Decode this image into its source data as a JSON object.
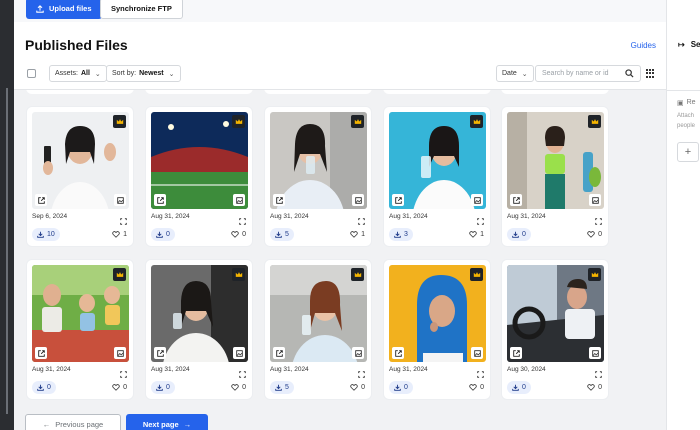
{
  "topbar": {
    "upload_label": "Upload files",
    "ftp_label": "Synchronize FTP"
  },
  "header": {
    "title": "Published Files",
    "guides_label": "Guides"
  },
  "toolbar": {
    "assets_label": "Assets:",
    "assets_value": "All",
    "sort_label": "Sort by:",
    "sort_value": "Newest",
    "date_label": "Date",
    "search_placeholder": "Search by name or id"
  },
  "files": [
    {
      "date": "Sep 6, 2024",
      "downloads": "10",
      "likes": "1",
      "art": "phone"
    },
    {
      "date": "Aug 31, 2024",
      "downloads": "0",
      "likes": "0",
      "art": "stadium"
    },
    {
      "date": "Aug 31, 2024",
      "downloads": "5",
      "likes": "1",
      "art": "kitchen"
    },
    {
      "date": "Aug 31, 2024",
      "downloads": "3",
      "likes": "1",
      "art": "blue"
    },
    {
      "date": "Aug 31, 2024",
      "downloads": "0",
      "likes": "0",
      "art": "gym"
    },
    {
      "date": "Aug 31, 2024",
      "downloads": "0",
      "likes": "0",
      "art": "picnic"
    },
    {
      "date": "Aug 31, 2024",
      "downloads": "0",
      "likes": "0",
      "art": "sofa"
    },
    {
      "date": "Aug 31, 2024",
      "downloads": "5",
      "likes": "0",
      "art": "glass"
    },
    {
      "date": "Aug 31, 2024",
      "downloads": "0",
      "likes": "0",
      "art": "hijab"
    },
    {
      "date": "Aug 30, 2024",
      "downloads": "0",
      "likes": "0",
      "art": "car"
    }
  ],
  "pagination": {
    "prev_label": "Previous page",
    "next_label": "Next page"
  },
  "right_panel": {
    "heading": "Se",
    "section": "Re",
    "line1": "Attach",
    "line2": "people",
    "add_icon": "plus-icon"
  },
  "colors": {
    "accent": "#2563eb",
    "badge": "#1f2328"
  }
}
